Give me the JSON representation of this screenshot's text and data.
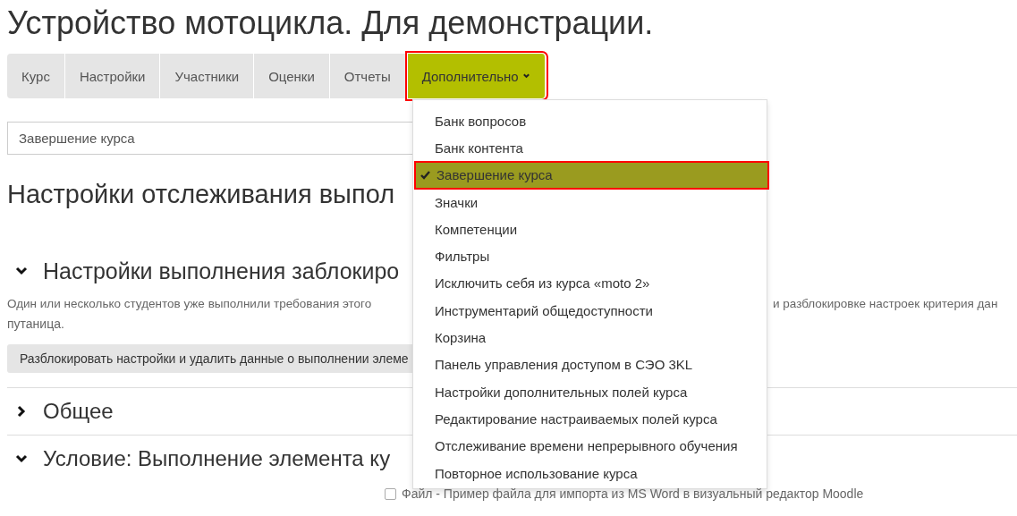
{
  "page_title": "Устройство мотоцикла. Для демонстрации.",
  "tabs": [
    {
      "label": "Курс",
      "selected": false,
      "highlighted": false
    },
    {
      "label": "Настройки",
      "selected": false,
      "highlighted": false
    },
    {
      "label": "Участники",
      "selected": false,
      "highlighted": false
    },
    {
      "label": "Оценки",
      "selected": false,
      "highlighted": false
    },
    {
      "label": "Отчеты",
      "selected": false,
      "highlighted": false
    },
    {
      "label": "Дополнительно",
      "selected": true,
      "highlighted": true,
      "kind": "dropdown"
    }
  ],
  "menu": {
    "items": [
      {
        "label": "Банк вопросов",
        "selected": false,
        "highlighted": false
      },
      {
        "label": "Банк контента",
        "selected": false,
        "highlighted": false
      },
      {
        "label": "Завершение курса",
        "selected": true,
        "highlighted": true
      },
      {
        "label": "Значки",
        "selected": false,
        "highlighted": false
      },
      {
        "label": "Компетенции",
        "selected": false,
        "highlighted": false
      },
      {
        "label": "Фильтры",
        "selected": false,
        "highlighted": false
      },
      {
        "label": "Исключить себя из курса «moto 2»",
        "selected": false,
        "highlighted": false
      },
      {
        "label": "Инструментарий общедоступности",
        "selected": false,
        "highlighted": false
      },
      {
        "label": "Корзина",
        "selected": false,
        "highlighted": false
      },
      {
        "label": "Панель управления доступом в СЭО 3KL",
        "selected": false,
        "highlighted": false
      },
      {
        "label": "Настройки дополнительных полей курса",
        "selected": false,
        "highlighted": false
      },
      {
        "label": "Редактирование настраиваемых полей курса",
        "selected": false,
        "highlighted": false
      },
      {
        "label": "Отслеживание времени непрерывного обучения",
        "selected": false,
        "highlighted": false
      },
      {
        "label": "Повторное использование курса",
        "selected": false,
        "highlighted": false
      }
    ]
  },
  "page_select": {
    "value": "Завершение курса"
  },
  "heading": "Настройки отслеживания выпол",
  "locked_section": {
    "title": "Настройки выполнения заблокиро",
    "expanded": true,
    "description_left": "Один или несколько студентов уже выполнили требования этого",
    "description_right": "и разблокировке настроек критерия дан",
    "description_line2": "путаница.",
    "unlock_button": "Разблокировать настройки и удалить данные о выполнении элеме"
  },
  "sections": [
    {
      "title": "Общее",
      "expanded": false
    },
    {
      "title": "Условие: Выполнение элемента ку",
      "expanded": true
    }
  ],
  "activities": [
    {
      "label": "Файл - Пример файла для импорта из MS Word в визуальный редактор Moodle",
      "checked": false
    }
  ]
}
